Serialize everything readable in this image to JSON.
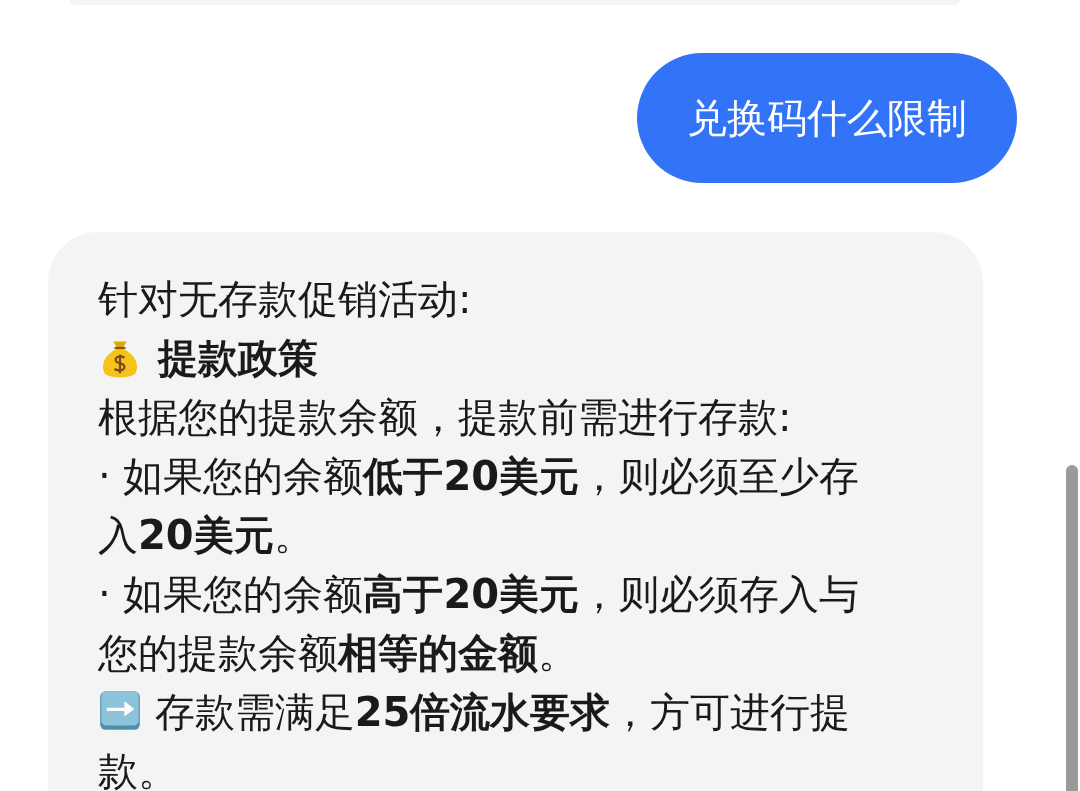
{
  "messages": [
    {
      "kind": "cut-off"
    },
    {
      "kind": "user",
      "text": "兑换码什么限制"
    },
    {
      "kind": "bot",
      "paragraphs": [
        {
          "kind": "text",
          "text": "针对无存款促销活动:"
        },
        {
          "kind": "heading",
          "text": "提款政策"
        },
        {
          "kind": "text",
          "text": "根据您的提款余额，提款前需进行存款:"
        },
        {
          "kind": "text",
          "text": "· 如果您的余额**低于20美元**，则必须至少存入**20美元**。"
        },
        {
          "kind": "text",
          "text": "· 如果您的余额**高于20美元**，则必须存入与您的提款余额**相等的金额**。"
        },
        {
          "kind": "note",
          "text": "存款需满足**25倍流水要求**，方可进行提款。"
        }
      ]
    }
  ]
}
